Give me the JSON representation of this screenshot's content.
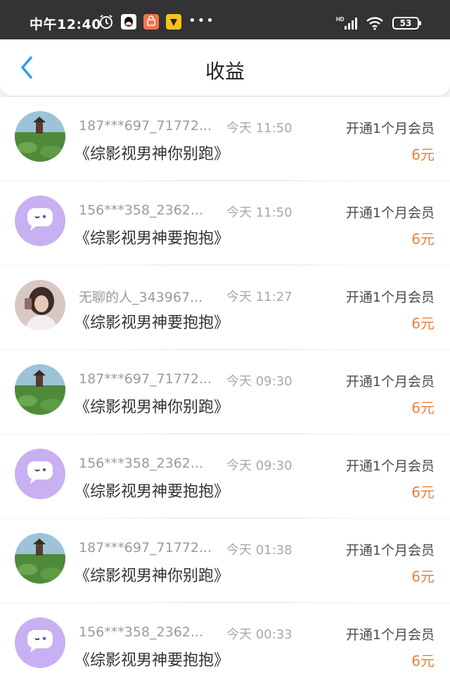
{
  "status_bar": {
    "time": "中午12:40",
    "icons": [
      "alarm-icon",
      "qq-icon",
      "app-shop-icon",
      "app-yellow-icon"
    ],
    "more": "•••",
    "signal": "HD",
    "battery": "53"
  },
  "header": {
    "back_icon": "chevron-left-icon",
    "title": "收益",
    "accent": "#2b9df4"
  },
  "earnings": [
    {
      "avatar": "lotus-pagoda",
      "name": "187***697_71772...",
      "time": "今天 11:50",
      "action": "开通1个月会员",
      "book": "《综影视男神你别跑》",
      "amount": "6元"
    },
    {
      "avatar": "purple-chat",
      "name": "156***358_2362...",
      "time": "今天 11:50",
      "action": "开通1个月会员",
      "book": "《综影视男神要抱抱》",
      "amount": "6元"
    },
    {
      "avatar": "girl-photo",
      "name": "无聊的人_343967...",
      "time": "今天 11:27",
      "action": "开通1个月会员",
      "book": "《综影视男神要抱抱》",
      "amount": "6元"
    },
    {
      "avatar": "lotus-pagoda",
      "name": "187***697_71772...",
      "time": "今天 09:30",
      "action": "开通1个月会员",
      "book": "《综影视男神你别跑》",
      "amount": "6元"
    },
    {
      "avatar": "purple-chat",
      "name": "156***358_2362...",
      "time": "今天 09:30",
      "action": "开通1个月会员",
      "book": "《综影视男神要抱抱》",
      "amount": "6元"
    },
    {
      "avatar": "lotus-pagoda",
      "name": "187***697_71772...",
      "time": "今天 01:38",
      "action": "开通1个月会员",
      "book": "《综影视男神你别跑》",
      "amount": "6元"
    },
    {
      "avatar": "purple-chat",
      "name": "156***358_2362...",
      "time": "今天 00:33",
      "action": "开通1个月会员",
      "book": "《综影视男神要抱抱》",
      "amount": "6元"
    }
  ],
  "colors": {
    "amount": "#e8813f",
    "status_bar_bg": "#333333",
    "chat_avatar_bg": "#c9b0f2"
  }
}
